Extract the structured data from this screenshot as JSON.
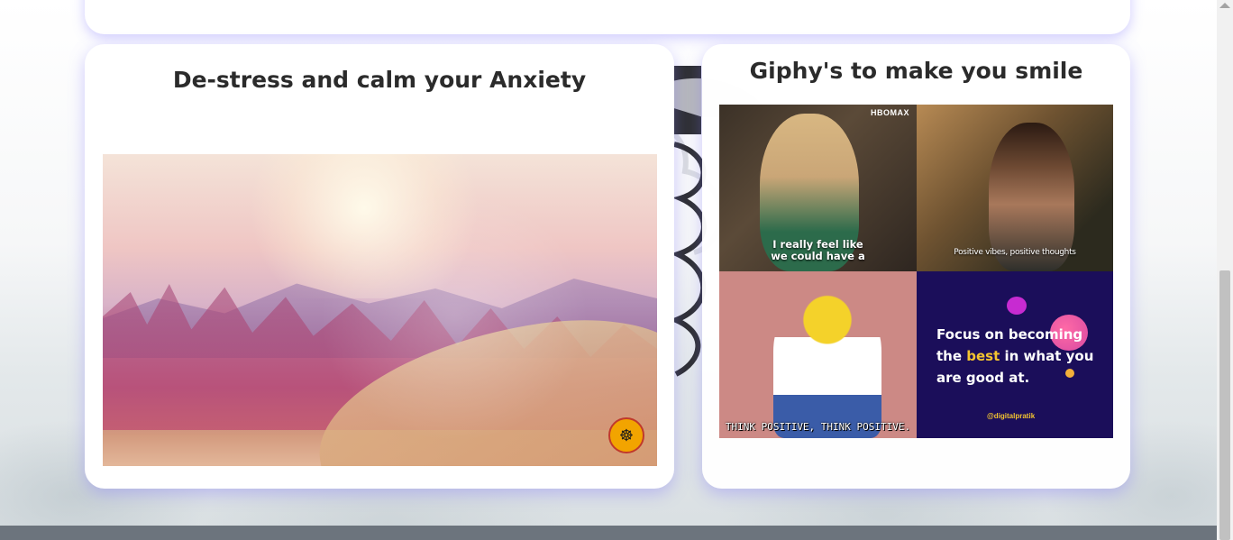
{
  "sections": {
    "anxiety": {
      "title": "De-stress and calm your Anxiety",
      "video_logo_icon": "meditation-icon"
    },
    "giphy": {
      "title": "Giphy's to make you smile",
      "gifs": [
        {
          "brand": "HBOMAX",
          "caption_line1": "I really feel like",
          "caption_line2": "we could have a"
        },
        {
          "caption": "Positive vibes, positive thoughts"
        },
        {
          "caption": "THINK POSITIVE, THINK POSITIVE."
        },
        {
          "quote_part1": "Focus on becoming the",
          "quote_highlight": "best",
          "quote_part2": "in what you are good at.",
          "handle": "@digitalpratik"
        }
      ]
    }
  },
  "colors": {
    "card_shadow": "#786eff",
    "title_text": "#2b2b2b",
    "footer": "#6c747d",
    "gif4_bg": "#1b0e5a",
    "gif4_highlight": "#f4c430"
  }
}
